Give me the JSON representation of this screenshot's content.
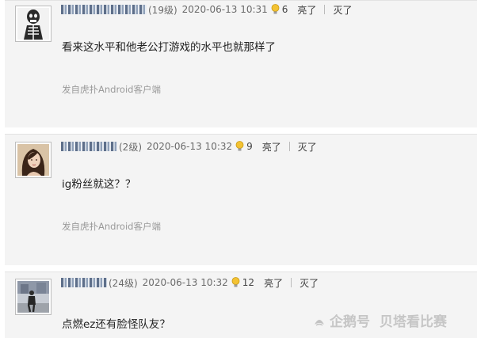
{
  "posts": [
    {
      "username": "user-1",
      "level": "(19级)",
      "datetime": "2020-06-13 10:31",
      "light_count": "6",
      "action_1": "亮了",
      "action_2": "灭了",
      "content": "看来这水平和他老公打游戏的水平也就那样了",
      "source": "发自虎扑Android客户端"
    },
    {
      "username": "user-2",
      "level": "(2级)",
      "datetime": "2020-06-13 10:32",
      "light_count": "9",
      "action_1": "亮了",
      "action_2": "灭了",
      "content": "ig粉丝就这？？",
      "source": "发自虎扑Android客户端"
    },
    {
      "username": "user-3",
      "level": "(24级)",
      "datetime": "2020-06-13 10:32",
      "light_count": "12",
      "action_1": "亮了",
      "action_2": "灭了",
      "content": "点燃ez还有脸怪队友？",
      "source": ""
    }
  ],
  "watermark": {
    "platform": "企鹅号",
    "author": "贝塔看比赛"
  },
  "colors": {
    "post_background": "#f4f4f4",
    "text": "#222222",
    "meta": "#6a6a6a",
    "source": "#9a9a9a"
  },
  "icons": {
    "light": "lightbulb-icon",
    "watermark_logo": "penguin-logo-icon"
  }
}
